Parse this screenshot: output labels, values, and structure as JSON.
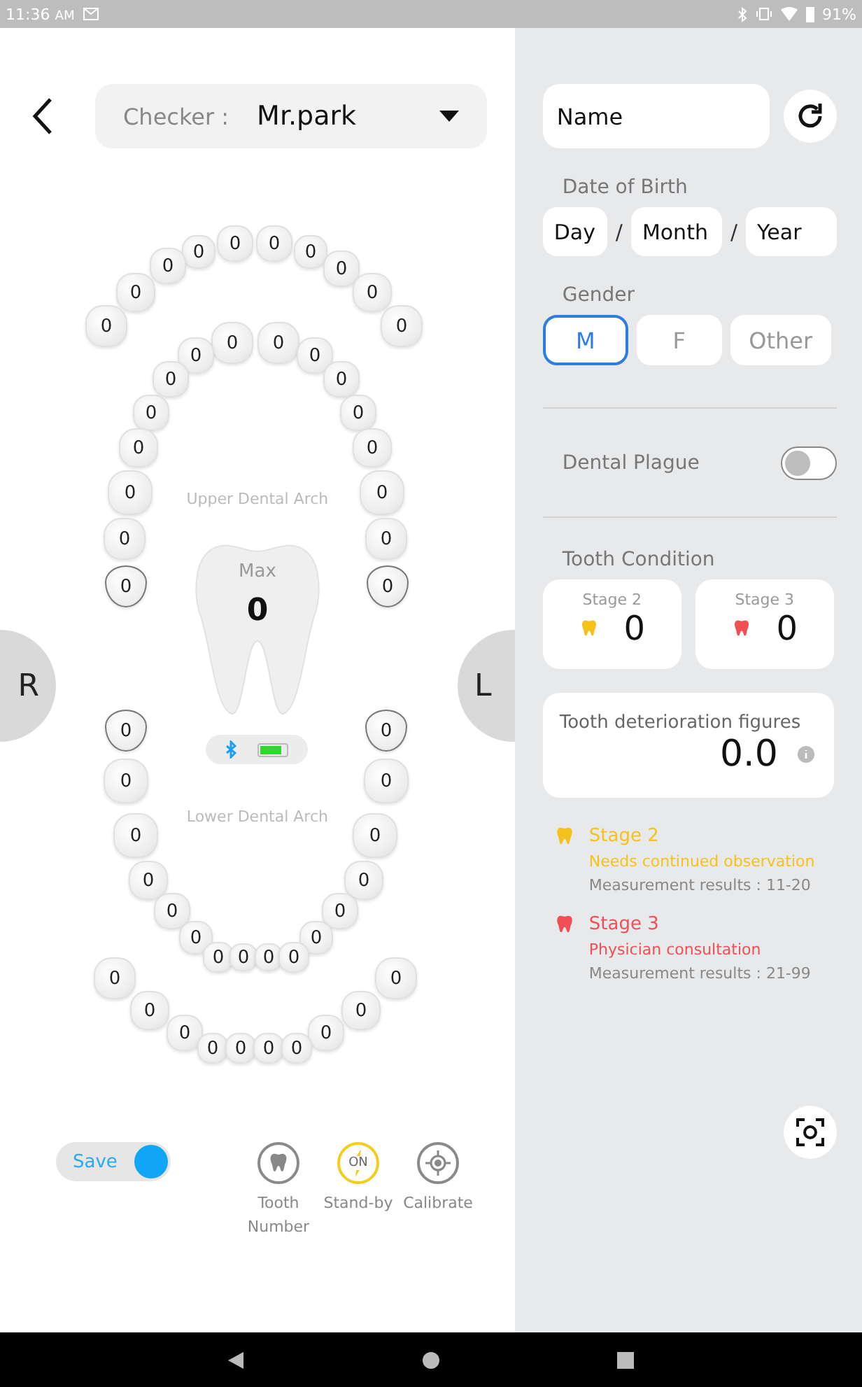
{
  "status_bar": {
    "time": "11:36",
    "meridiem": "AM",
    "battery": "91%"
  },
  "header": {
    "checker_label": "Checker :",
    "checker_value": "Mr.park"
  },
  "arch": {
    "upper_label": "Upper Dental Arch",
    "lower_label": "Lower Dental Arch",
    "upper_outer": [
      "0",
      "0",
      "0",
      "0",
      "0",
      "0",
      "0",
      "0",
      "0",
      "0"
    ],
    "upper_inner": [
      "0",
      "0",
      "0",
      "0",
      "0",
      "0",
      "0",
      "0",
      "0",
      "0",
      "0",
      "0",
      "0",
      "0",
      "0",
      "0"
    ],
    "lower_inner": [
      "0",
      "0",
      "0",
      "0",
      "0",
      "0",
      "0",
      "0",
      "0",
      "0",
      "0",
      "0",
      "0",
      "0",
      "0",
      "0"
    ],
    "lower_outer": [
      "0",
      "0",
      "0",
      "0",
      "0",
      "0",
      "0",
      "0",
      "0",
      "0"
    ]
  },
  "max": {
    "label": "Max",
    "value": "0"
  },
  "device": {
    "bluetooth_connected": true,
    "level": 0.8
  },
  "sides": {
    "right": "R",
    "left": "L"
  },
  "save_toggle": {
    "label": "Save",
    "on": true
  },
  "tools": [
    {
      "kind": "tooth",
      "label": "Tooth Number"
    },
    {
      "kind": "standby",
      "label": "Stand-by",
      "badge": "ON",
      "on": true
    },
    {
      "kind": "calibrate",
      "label": "Calibrate"
    }
  ],
  "name_field": {
    "placeholder": "Name"
  },
  "date_of_birth": {
    "label": "Date of Birth",
    "fields": [
      {
        "placeholder": "Day"
      },
      {
        "placeholder": "Month"
      },
      {
        "placeholder": "Year"
      }
    ],
    "separators": [
      "/",
      "/"
    ]
  },
  "gender": {
    "label": "Gender",
    "options": [
      {
        "label": "M",
        "selected": true
      },
      {
        "label": "F",
        "selected": false
      },
      {
        "label": "Other",
        "selected": false
      }
    ]
  },
  "dental_plague": {
    "label": "Dental Plague",
    "on": false
  },
  "tooth_condition": {
    "label": "Tooth Condition",
    "stages": [
      {
        "label": "Stage 2",
        "value": "0",
        "color": "#f5c21b"
      },
      {
        "label": "Stage 3",
        "value": "0",
        "color": "#f04f55"
      }
    ]
  },
  "deterioration": {
    "label": "Tooth deterioration figures",
    "value": "0.0"
  },
  "legend": [
    {
      "title": "Stage 2",
      "description": "Needs continued observation",
      "range": "Measurement results : 11-20",
      "color": "#f5c21b"
    },
    {
      "title": "Stage 3",
      "description": "Physician consultation",
      "range": "Measurement results : 21-99",
      "color": "#f04f55"
    }
  ]
}
